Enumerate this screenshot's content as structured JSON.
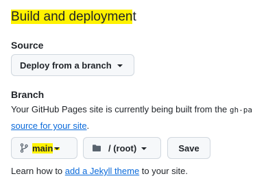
{
  "section": {
    "title_highlighted": "Build and deploymen",
    "title_rest": "t"
  },
  "source": {
    "label": "Source",
    "dropdown_label": "Deploy from a branch"
  },
  "branch": {
    "label": "Branch",
    "description_prefix": "Your GitHub Pages site is currently being built from the ",
    "description_code": "gh-pa",
    "description_link": "source for your site",
    "description_suffix": ".",
    "branch_button_label": "main",
    "branch_button_icon": "git-branch-icon",
    "folder_button_label": "/ (root)",
    "folder_button_icon": "folder-icon",
    "save_label": "Save"
  },
  "footer": {
    "prefix": "Learn how to ",
    "link": "add a Jekyll theme",
    "suffix": " to your site."
  },
  "colors": {
    "highlight": "#fff200",
    "link": "#0969da",
    "button_bg": "#f6f8fa",
    "border": "#d0d7de",
    "text": "#1f2328"
  }
}
